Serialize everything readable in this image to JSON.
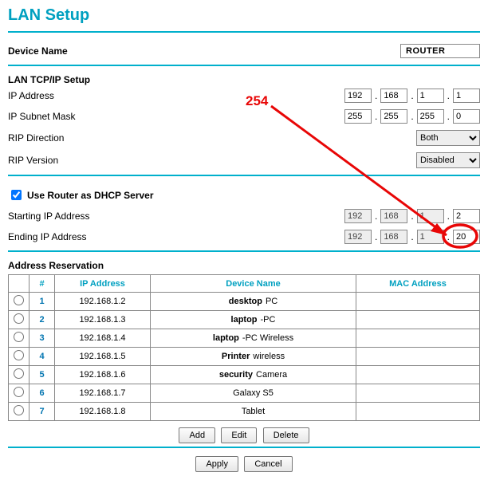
{
  "page_title": "LAN Setup",
  "device_name": {
    "label": "Device Name",
    "value": "ROUTER"
  },
  "tcpip": {
    "header": "LAN TCP/IP Setup",
    "ip_address": {
      "label": "IP Address",
      "oct1": "192",
      "oct2": "168",
      "oct3": "1",
      "oct4": "1"
    },
    "subnet": {
      "label": "IP Subnet Mask",
      "oct1": "255",
      "oct2": "255",
      "oct3": "255",
      "oct4": "0"
    },
    "rip_direction": {
      "label": "RIP Direction",
      "value": "Both"
    },
    "rip_version": {
      "label": "RIP Version",
      "value": "Disabled"
    }
  },
  "dhcp": {
    "checkbox_label": "Use Router as DHCP Server",
    "checked": true,
    "start": {
      "label": "Starting IP Address",
      "oct1": "192",
      "oct2": "168",
      "oct3": "1",
      "oct4": "2"
    },
    "end": {
      "label": "Ending IP Address",
      "oct1": "192",
      "oct2": "168",
      "oct3": "1",
      "oct4": "20"
    }
  },
  "reservation": {
    "header": "Address Reservation",
    "columns": {
      "num": "#",
      "ip": "IP Address",
      "dev": "Device Name",
      "mac": "MAC Address"
    },
    "rows": [
      {
        "n": "1",
        "ip": "192.168.1.2",
        "dev_bold": "desktop",
        "dev_rest": "PC",
        "mac": ""
      },
      {
        "n": "2",
        "ip": "192.168.1.3",
        "dev_bold": "laptop",
        "dev_rest": "-PC",
        "mac": ""
      },
      {
        "n": "3",
        "ip": "192.168.1.4",
        "dev_bold": "laptop",
        "dev_rest": "-PC Wireless",
        "mac": ""
      },
      {
        "n": "4",
        "ip": "192.168.1.5",
        "dev_bold": "Printer",
        "dev_rest": "wireless",
        "mac": ""
      },
      {
        "n": "5",
        "ip": "192.168.1.6",
        "dev_bold": "security",
        "dev_rest": "Camera",
        "mac": ""
      },
      {
        "n": "6",
        "ip": "192.168.1.7",
        "dev_bold": "",
        "dev_rest": "Galaxy S5",
        "mac": ""
      },
      {
        "n": "7",
        "ip": "192.168.1.8",
        "dev_bold": "",
        "dev_rest": "Tablet",
        "mac": ""
      }
    ]
  },
  "buttons": {
    "add": "Add",
    "edit": "Edit",
    "delete": "Delete",
    "apply": "Apply",
    "cancel": "Cancel"
  },
  "annotation": {
    "label": "254"
  }
}
